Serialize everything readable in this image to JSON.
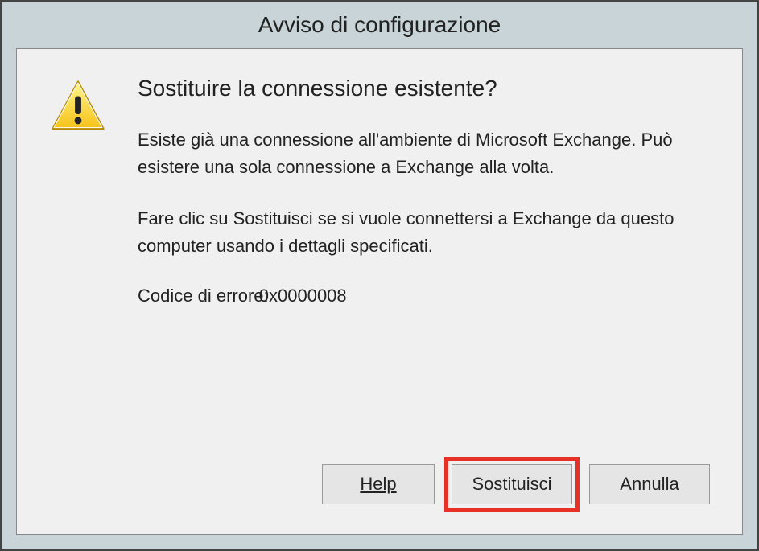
{
  "title": "Avviso di configurazione",
  "headline": "Sostituire la connessione esistente?",
  "paragraph1": "Esiste già una connessione all'ambiente di Microsoft Exchange. Può esistere una sola connessione a Exchange alla volta.",
  "paragraph2": "Fare clic su Sostituisci se si vuole connettersi a Exchange da questo computer usando i dettagli specificati.",
  "error_label": "Codice di errore:",
  "error_code": "0x0000008",
  "buttons": {
    "help": "Help",
    "replace": "Sostituisci",
    "cancel": "Annulla"
  }
}
